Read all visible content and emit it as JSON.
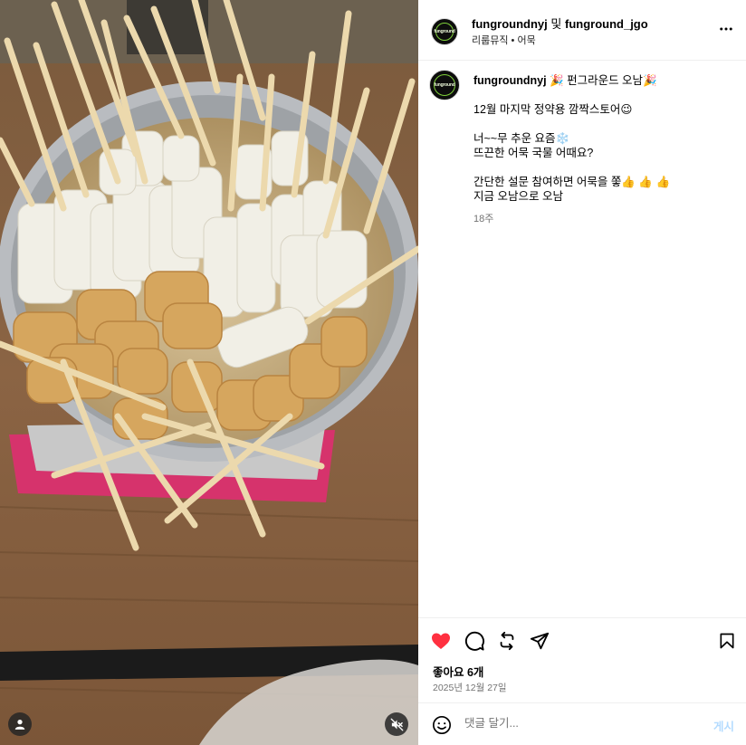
{
  "media": {
    "photo_icon": "odeng-skewers-photo",
    "user_tag_icon": "person-icon",
    "mute_icon": "speaker-muted-icon"
  },
  "header": {
    "author": "fungroundnyj",
    "joiner": "및",
    "collaborator": "funground_jgo",
    "subtitle": "리룹뮤직 • 어묵",
    "avatar_logo": "funground",
    "more_icon": "ellipsis-icon"
  },
  "caption": {
    "username": "fungroundnyj",
    "title_text": "🎉 펀그라운드 오남🎉",
    "lines": [
      "12월 마지막 정약용 깜짝스토어😉",
      "",
      "너~~무 추운 요즘❄️",
      "뜨끈한 어묵 국물 어때요?",
      "",
      "간단한 설문 참여하면 어묵을 쫗👍 👍 👍",
      "지금 오남으로 오남"
    ],
    "age": "18주"
  },
  "actions": {
    "like_icon": "heart-filled-icon",
    "comment_icon": "comment-icon",
    "repost_icon": "repost-icon",
    "share_icon": "send-icon",
    "save_icon": "bookmark-icon",
    "likes_text": "좋아요 6개",
    "date_text": "2025년 12월 27일",
    "like_color": "#ff3040"
  },
  "comment_bar": {
    "emoji_icon": "smiley-icon",
    "placeholder": "댓글 달기...",
    "post_label": "게시",
    "post_color": "#b3dbff"
  }
}
